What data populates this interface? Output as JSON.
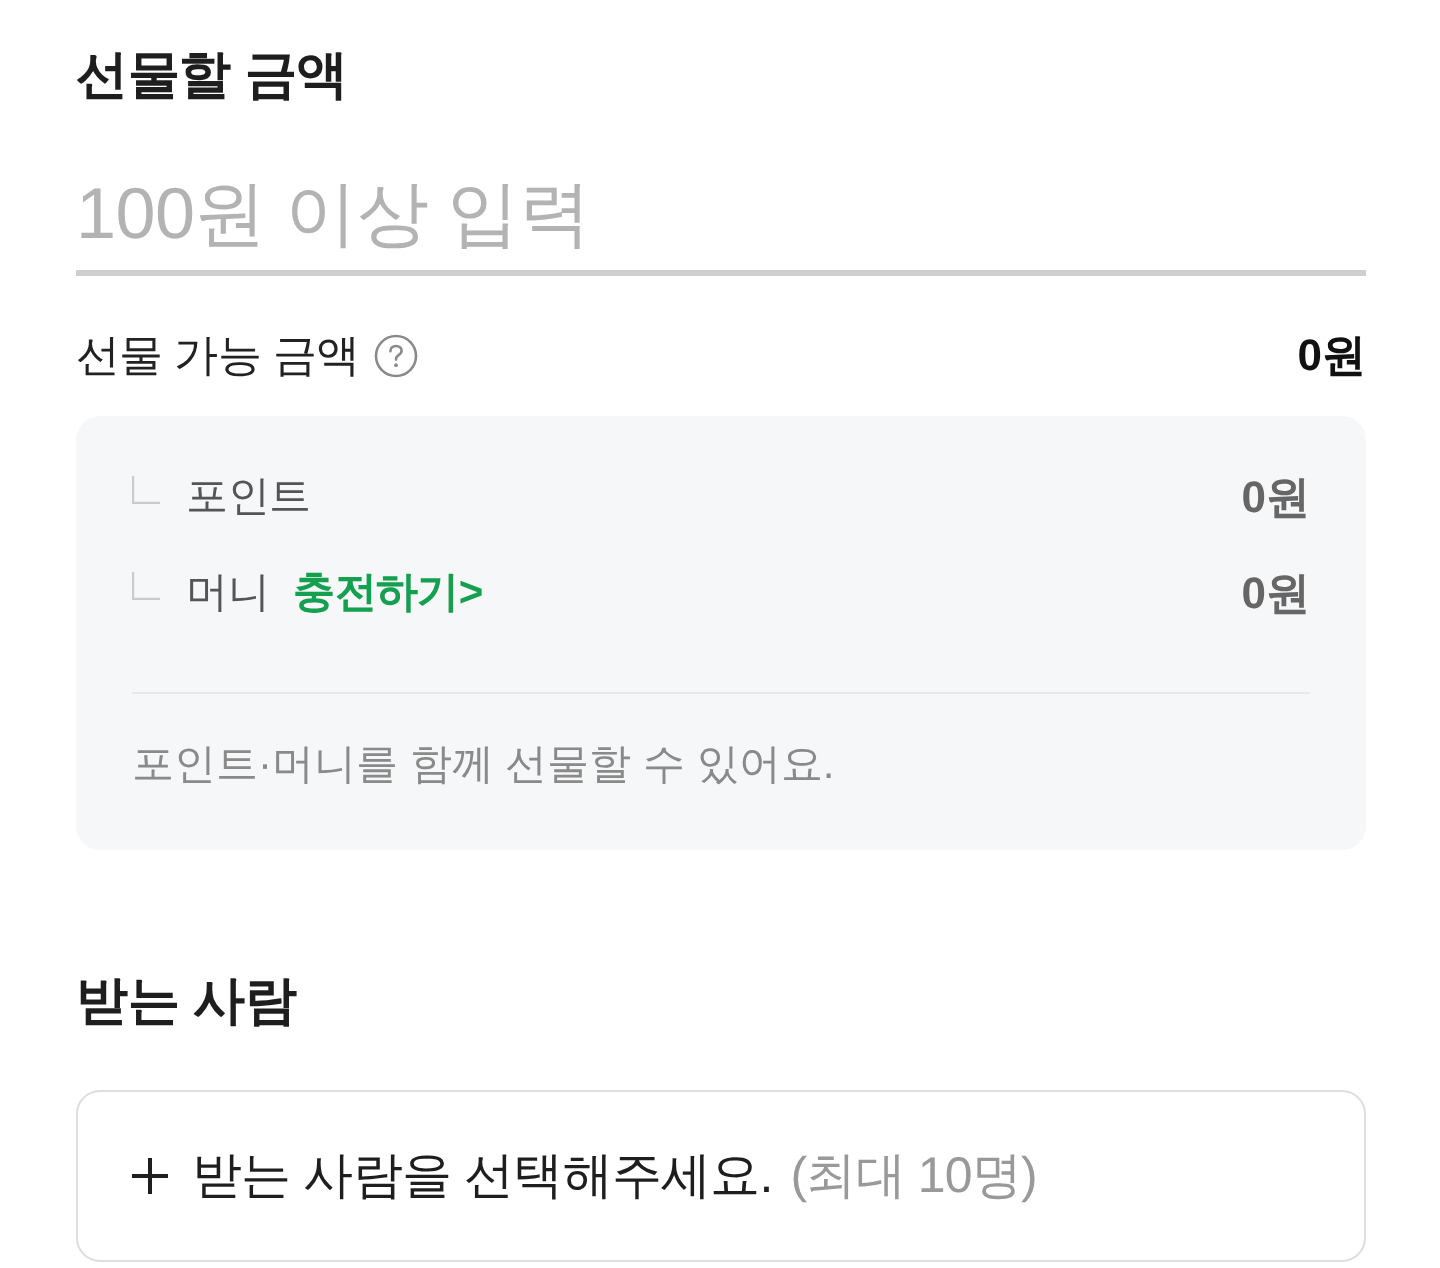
{
  "gift_amount": {
    "title": "선물할 금액",
    "input": {
      "placeholder": "100원 이상 입력"
    }
  },
  "available": {
    "label": "선물 가능 금액",
    "total": "0원",
    "breakdown": [
      {
        "label": "포인트",
        "value": "0원"
      },
      {
        "label": "머니",
        "link": "충전하기>",
        "value": "0원"
      }
    ],
    "note": "포인트·머니를 함께 선물할 수 있어요."
  },
  "recipient": {
    "title": "받는 사람",
    "button": {
      "text": "받는 사람을 선택해주세요.",
      "limit": "(최대 10명)"
    }
  }
}
